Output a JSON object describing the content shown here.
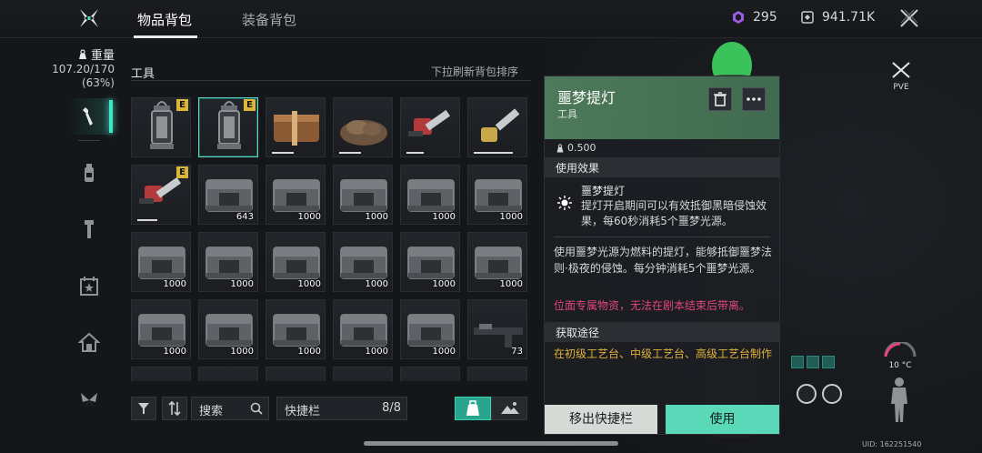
{
  "header": {
    "tabs": [
      {
        "label": "物品背包",
        "active": true
      },
      {
        "label": "装备背包",
        "active": false
      }
    ],
    "currency_1": "295",
    "currency_2": "941.71K"
  },
  "left_nav": {
    "weight_label": "重量",
    "weight_value": "107.20/170",
    "weight_percent": "(63%)",
    "items": [
      "wrench-icon",
      "bottle-icon",
      "bolt-icon",
      "calendar-star-icon",
      "home-icon",
      "butterfly-icon"
    ]
  },
  "inventory": {
    "section_title": "工具",
    "refresh_hint": "下拉刷新背包排序",
    "badge_text": "E",
    "slots": [
      {
        "icon": "lantern",
        "badge": true,
        "count": "",
        "durability": 0
      },
      {
        "icon": "lantern",
        "badge": true,
        "count": "",
        "durability": 0,
        "selected": true
      },
      {
        "icon": "wood-bundle",
        "badge": false,
        "count": "",
        "durability": 0.45
      },
      {
        "icon": "rock-pile",
        "badge": false,
        "count": "",
        "durability": 0.45
      },
      {
        "icon": "chainsaw-red",
        "badge": false,
        "count": "",
        "durability": 0.35
      },
      {
        "icon": "chainsaw-gold",
        "badge": false,
        "count": "",
        "durability": 0.8
      },
      {
        "icon": "chainsaw-red",
        "badge": true,
        "count": "",
        "durability": 0.4
      },
      {
        "icon": "crate",
        "badge": false,
        "count": "643",
        "durability": 0
      },
      {
        "icon": "crate",
        "badge": false,
        "count": "1000",
        "durability": 0
      },
      {
        "icon": "crate",
        "badge": false,
        "count": "1000",
        "durability": 0
      },
      {
        "icon": "crate",
        "badge": false,
        "count": "1000",
        "durability": 0
      },
      {
        "icon": "crate",
        "badge": false,
        "count": "1000",
        "durability": 0
      },
      {
        "icon": "crate",
        "badge": false,
        "count": "1000",
        "durability": 0
      },
      {
        "icon": "crate",
        "badge": false,
        "count": "1000",
        "durability": 0
      },
      {
        "icon": "crate",
        "badge": false,
        "count": "1000",
        "durability": 0
      },
      {
        "icon": "crate",
        "badge": false,
        "count": "1000",
        "durability": 0
      },
      {
        "icon": "crate",
        "badge": false,
        "count": "1000",
        "durability": 0
      },
      {
        "icon": "crate",
        "badge": false,
        "count": "1000",
        "durability": 0
      },
      {
        "icon": "crate",
        "badge": false,
        "count": "1000",
        "durability": 0
      },
      {
        "icon": "crate",
        "badge": false,
        "count": "1000",
        "durability": 0
      },
      {
        "icon": "crate",
        "badge": false,
        "count": "1000",
        "durability": 0
      },
      {
        "icon": "crate",
        "badge": false,
        "count": "1000",
        "durability": 0
      },
      {
        "icon": "crate",
        "badge": false,
        "count": "1000",
        "durability": 0
      },
      {
        "icon": "rifle",
        "badge": false,
        "count": "73",
        "durability": 0
      },
      {
        "icon": "empty",
        "badge": false,
        "count": "",
        "durability": 0
      },
      {
        "icon": "empty",
        "badge": false,
        "count": "",
        "durability": 0
      },
      {
        "icon": "empty",
        "badge": false,
        "count": "",
        "durability": 0
      },
      {
        "icon": "empty",
        "badge": false,
        "count": "",
        "durability": 0
      },
      {
        "icon": "empty",
        "badge": false,
        "count": "",
        "durability": 0
      },
      {
        "icon": "empty",
        "badge": false,
        "count": "",
        "durability": 0
      }
    ]
  },
  "toolbar": {
    "search_label": "搜索",
    "quickbar_label": "快捷栏",
    "quickbar_count": "8/8"
  },
  "detail": {
    "name": "噩梦提灯",
    "type": "工具",
    "weight": "0.500",
    "effect_header": "使用效果",
    "effect_title": "噩梦提灯",
    "effect_desc": "提灯开启期间可以有效抵御黑暗侵蚀效果，每60秒消耗5个噩梦光源。",
    "description": "使用噩梦光源为燃料的提灯，能够抵御噩梦法则·极夜的侵蚀。每分钟消耗5个噩梦光源。",
    "warning": "位面专属物资，无法在剧本结束后带离。",
    "source_header": "获取途径",
    "source_text": "在初级工艺台、中级工艺台、高级工艺台制作",
    "remove_button": "移出快捷栏",
    "use_button": "使用"
  },
  "right_hud": {
    "mode": "PVE",
    "temperature": "10 °C",
    "uid": "UID: 162251540"
  },
  "colors": {
    "accent": "#5bd8b8",
    "detail_header": "#4d7a5a",
    "warning": "#e0457e",
    "source": "#e1b23a",
    "badge": "#d9b53a"
  }
}
